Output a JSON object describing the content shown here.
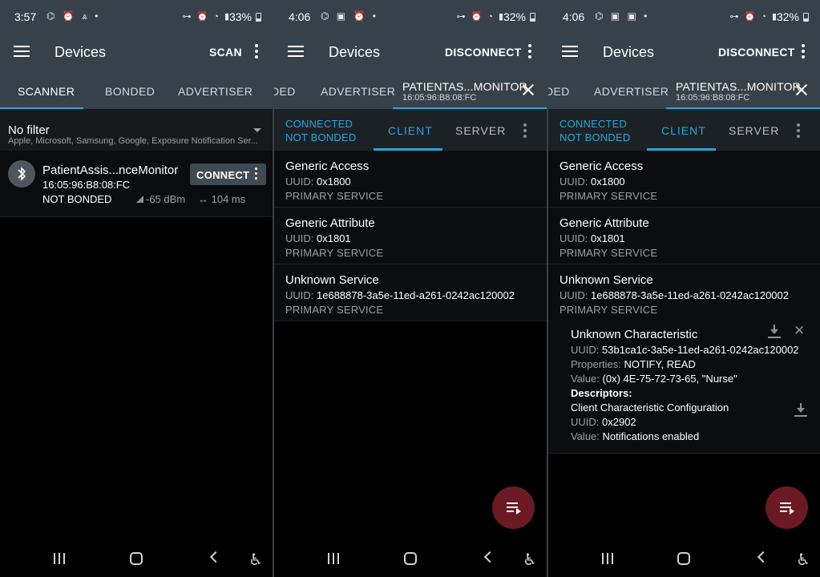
{
  "panel1": {
    "status": {
      "time": "3:57",
      "notif": "⌬ ⏰ ⩓ •",
      "sys": "⊶ ⏰ ◔ ▮",
      "battery": "33%"
    },
    "appbar": {
      "title": "Devices",
      "action": "SCAN"
    },
    "tabs": {
      "scanner": "SCANNER",
      "bonded": "BONDED",
      "advertiser": "ADVERTISER"
    },
    "filter": {
      "title": "No filter",
      "subtitle": "Apple, Microsoft, Samsung, Google, Exposure Notification Ser..."
    },
    "device": {
      "name": "PatientAssis...nceMonitor",
      "address": "16:05:96:B8:08:FC",
      "bond": "NOT BONDED",
      "rssi": "-65 dBm",
      "interval": "104 ms",
      "connect": "CONNECT"
    }
  },
  "panel2": {
    "status": {
      "time": "4:06",
      "notif": "⌬ ▣ ⏰ •",
      "sys": "⊶ ⏰ ◔ ▮",
      "battery": "32%"
    },
    "appbar": {
      "title": "Devices",
      "action": "DISCONNECT"
    },
    "tabs": {
      "partial": "DED",
      "advertiser": "ADVERTISER",
      "device_name": "PATIENTAS...MONITOR",
      "device_addr": "16:05:96:B8:08:FC"
    },
    "state": {
      "connected": "CONNECTED",
      "bond": "NOT BONDED"
    },
    "subtabs": {
      "client": "CLIENT",
      "server": "SERVER"
    },
    "services": [
      {
        "name": "Generic Access",
        "uuid_label": "UUID:",
        "uuid": "0x1800",
        "type": "PRIMARY SERVICE"
      },
      {
        "name": "Generic Attribute",
        "uuid_label": "UUID:",
        "uuid": "0x1801",
        "type": "PRIMARY SERVICE"
      },
      {
        "name": "Unknown Service",
        "uuid_label": "UUID:",
        "uuid": "1e688878-3a5e-11ed-a261-0242ac120002",
        "type": "PRIMARY SERVICE"
      }
    ]
  },
  "panel3": {
    "status": {
      "time": "4:06",
      "notif": "⌬ ▣ ▣ •",
      "sys": "⊶ ⏰ ◔ ▮",
      "battery": "32%"
    },
    "appbar": {
      "title": "Devices",
      "action": "DISCONNECT"
    },
    "tabs": {
      "partial": "DED",
      "advertiser": "ADVERTISER",
      "device_name": "PATIENTAS...MONITOR",
      "device_addr": "16:05:96:B8:08:FC"
    },
    "state": {
      "connected": "CONNECTED",
      "bond": "NOT BONDED"
    },
    "subtabs": {
      "client": "CLIENT",
      "server": "SERVER"
    },
    "services": [
      {
        "name": "Generic Access",
        "uuid_label": "UUID:",
        "uuid": "0x1800",
        "type": "PRIMARY SERVICE"
      },
      {
        "name": "Generic Attribute",
        "uuid_label": "UUID:",
        "uuid": "0x1801",
        "type": "PRIMARY SERVICE"
      },
      {
        "name": "Unknown Service",
        "uuid_label": "UUID:",
        "uuid": "1e688878-3a5e-11ed-a261-0242ac120002",
        "type": "PRIMARY SERVICE"
      }
    ],
    "characteristic": {
      "name": "Unknown Characteristic",
      "uuid_label": "UUID:",
      "uuid": "53b1ca1c-3a5e-11ed-a261-0242ac120002",
      "props_label": "Properties:",
      "props": "NOTIFY, READ",
      "value_label": "Value:",
      "value": "(0x) 4E-75-72-73-65, \"Nurse\"",
      "descriptors_label": "Descriptors:",
      "descriptor_name": "Client Characteristic Configuration",
      "descriptor_uuid_label": "UUID:",
      "descriptor_uuid": "0x2902",
      "descriptor_value_label": "Value:",
      "descriptor_value": "Notifications enabled"
    }
  },
  "icons": {
    "menu": "menu-icon",
    "more": "more-vert-icon",
    "bluetooth": "bluetooth-icon",
    "signal": "signal-icon",
    "interval": "swap-horiz-icon",
    "close": "close-icon",
    "download": "download-icon",
    "notify_off": "notifications-off-icon",
    "log": "log-icon"
  },
  "colors": {
    "accent": "#2aa6d5",
    "appbar": "#37414a",
    "fab": "#6b1a24"
  }
}
